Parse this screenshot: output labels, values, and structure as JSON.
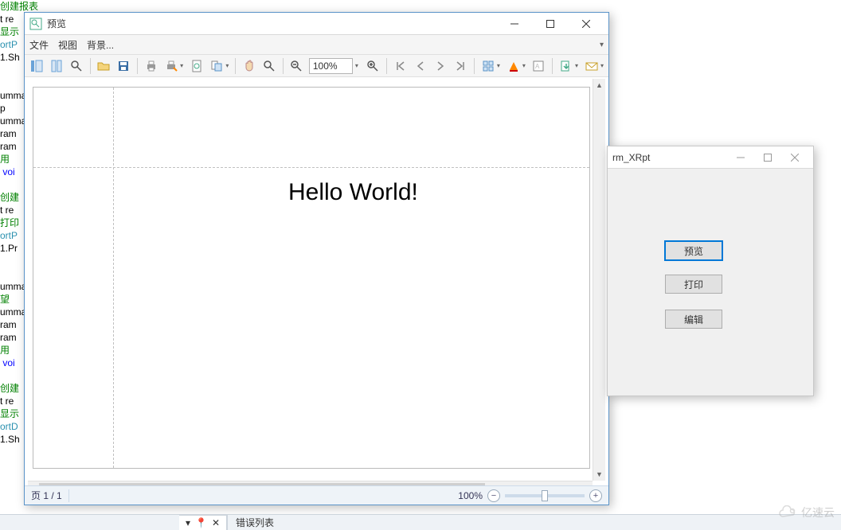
{
  "code_background": [
    {
      "t": "创建报表",
      "c": "c-green"
    },
    {
      "t": "t re",
      "c": "c-black"
    },
    {
      "t": "显示",
      "c": "c-green"
    },
    {
      "t": "ortP",
      "c": "c-teal"
    },
    {
      "t": "1.Sh",
      "c": "c-black"
    },
    {
      "t": "",
      "c": ""
    },
    {
      "t": "",
      "c": ""
    },
    {
      "t": "umma",
      "c": "c-black"
    },
    {
      "t": "p",
      "c": "c-black"
    },
    {
      "t": "umma",
      "c": "c-black"
    },
    {
      "t": "ram",
      "c": "c-black"
    },
    {
      "t": "ram",
      "c": "c-black"
    },
    {
      "t": "用",
      "c": "c-green"
    },
    {
      "t": " voi",
      "c": "c-blue"
    },
    {
      "t": "",
      "c": ""
    },
    {
      "t": "创建",
      "c": "c-green"
    },
    {
      "t": "t re",
      "c": "c-black"
    },
    {
      "t": "打印",
      "c": "c-green"
    },
    {
      "t": "ortP",
      "c": "c-teal"
    },
    {
      "t": "1.Pr",
      "c": "c-black"
    },
    {
      "t": "",
      "c": ""
    },
    {
      "t": "",
      "c": ""
    },
    {
      "t": "umma",
      "c": "c-black"
    },
    {
      "t": "望",
      "c": "c-green"
    },
    {
      "t": "umma",
      "c": "c-black"
    },
    {
      "t": "ram",
      "c": "c-black"
    },
    {
      "t": "ram",
      "c": "c-black"
    },
    {
      "t": "用",
      "c": "c-green"
    },
    {
      "t": " voi",
      "c": "c-blue"
    },
    {
      "t": "",
      "c": ""
    },
    {
      "t": "创建",
      "c": "c-green"
    },
    {
      "t": "t re",
      "c": "c-black"
    },
    {
      "t": "显示",
      "c": "c-green"
    },
    {
      "t": "ortD",
      "c": "c-teal"
    },
    {
      "t": "1.Sh",
      "c": "c-black"
    }
  ],
  "preview_window": {
    "title": "预览",
    "menu": {
      "file": "文件",
      "view": "视图",
      "background": "背景..."
    },
    "toolbar": {
      "zoom_value": "100%",
      "icons": {
        "thumbnails": "thumbnails-icon",
        "bookmarks": "bookmarks-icon",
        "find": "find-icon",
        "open": "open-folder-icon",
        "save": "save-icon",
        "print": "print-icon",
        "quick_print": "quick-print-icon",
        "page_setup": "page-setup-icon",
        "scale": "scale-icon",
        "hand": "hand-tool-icon",
        "magnifier": "magnifier-icon",
        "zoom_out": "zoom-out-icon",
        "zoom_in": "zoom-in-icon",
        "first_page": "first-page-icon",
        "prev_page": "prev-page-icon",
        "next_page": "next-page-icon",
        "last_page": "last-page-icon",
        "many_pages": "many-pages-icon",
        "color": "color-icon",
        "watermark": "watermark-icon",
        "export": "export-icon",
        "send": "send-icon"
      }
    },
    "document": {
      "body_text": "Hello World!"
    },
    "status": {
      "page_label": "页 1 / 1",
      "zoom_label": "100%"
    }
  },
  "form_window": {
    "title": "rm_XRpt",
    "buttons": {
      "preview": "预览",
      "print": "打印",
      "edit": "编辑"
    }
  },
  "vs_strip": {
    "pin_glyph": "▾",
    "pin_glyph2": "📌",
    "close_glyph": "✕",
    "error_list": "错误列表"
  },
  "watermark": {
    "text": "亿速云"
  }
}
